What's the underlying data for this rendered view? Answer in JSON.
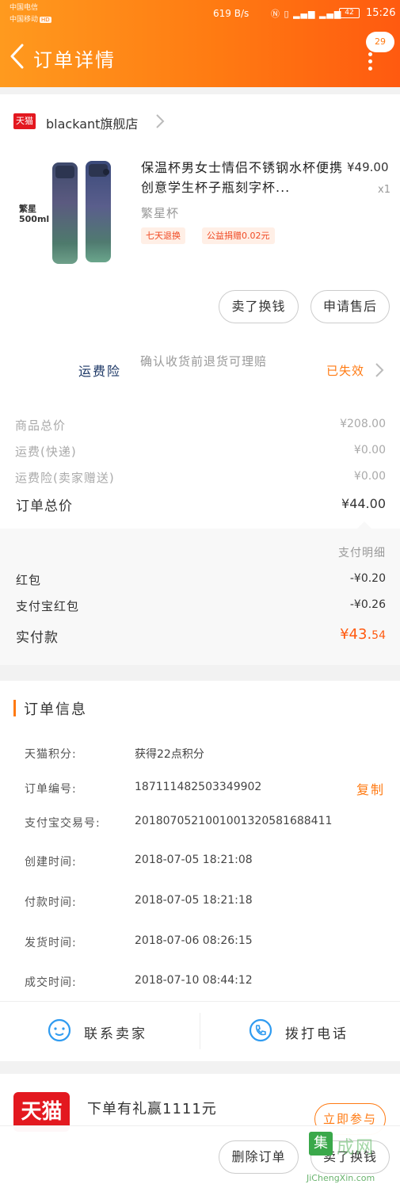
{
  "status_bar": {
    "carrier_1": "中国电信",
    "carrier_2": "中国移动",
    "hd": "HD",
    "speed": "619 B/s",
    "battery": "42",
    "time": "15:26"
  },
  "header": {
    "title": "订单详情",
    "message_count": "29"
  },
  "shop": {
    "badge": "天猫",
    "name": "blackant旗舰店"
  },
  "product": {
    "image_label_1": "繁星",
    "image_label_2": "500ml",
    "title": "保温杯男女士情侣不锈钢水杯便携创意学生杯子瓶刻字杯...",
    "price": "¥49.00",
    "quantity": "x1",
    "variant": "繁星杯",
    "tags": [
      "七天退换",
      "公益捐赠0.02元"
    ]
  },
  "actions": {
    "sell_exchange": "卖了换钱",
    "after_sale": "申请售后"
  },
  "insurance": {
    "label": "运费险",
    "desc": "确认收货前退货可理赔",
    "status": "已失效"
  },
  "fees": [
    {
      "label": "商品总价",
      "value": "¥208.00"
    },
    {
      "label": "运费(快递)",
      "value": "¥0.00"
    },
    {
      "label": "运费险(卖家赠送)",
      "value": "¥0.00"
    }
  ],
  "order_total": {
    "label": "订单总价",
    "value": "¥44.00"
  },
  "payment": {
    "detail_label": "支付明细",
    "rows": [
      {
        "label": "红包",
        "value": "-¥0.20"
      },
      {
        "label": "支付宝红包",
        "value": "-¥0.26"
      }
    ],
    "paid_label": "实付款",
    "paid_main": "¥43.",
    "paid_cents": "54"
  },
  "order_info": {
    "title": "订单信息",
    "rows": [
      {
        "label": "天猫积分:",
        "value": "获得22点积分"
      },
      {
        "label": "订单编号:",
        "value": "187111482503349902"
      },
      {
        "label": "支付宝交易号:",
        "value": "2018070521001001320581688411"
      },
      {
        "label": "创建时间:",
        "value": "2018-07-05  18:21:08"
      },
      {
        "label": "付款时间:",
        "value": "2018-07-05  18:21:18"
      },
      {
        "label": "发货时间:",
        "value": "2018-07-06  08:26:15"
      },
      {
        "label": "成交时间:",
        "value": "2018-07-10  08:44:12"
      }
    ],
    "copy": "复制"
  },
  "contact": {
    "seller": "联系卖家",
    "phone": "拨打电话"
  },
  "promo": {
    "logo": "天猫",
    "text": "下单有礼赢1111元",
    "join": "立即参与"
  },
  "bottom": {
    "delete_order": "删除订单",
    "sell_exchange": "卖了换钱"
  },
  "watermark": {
    "box": "集",
    "text": "成网",
    "url": "JiChengXin.com"
  },
  "colors": {
    "brand_orange": "#ff7a12",
    "tmall_red": "#e3181f",
    "price_red": "#ff5a10"
  }
}
